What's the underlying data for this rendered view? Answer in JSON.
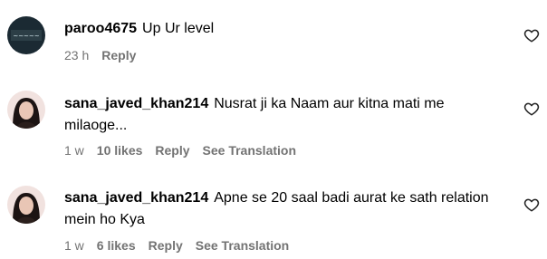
{
  "comments": [
    {
      "username": "paroo4675",
      "text": "Up Ur level",
      "time": "23 h",
      "likes": "",
      "reply_label": "Reply",
      "translation_label": ""
    },
    {
      "username": "sana_javed_khan214",
      "text": "Nusrat ji ka Naam aur kitna mati me milaoge...",
      "time": "1 w",
      "likes": "10 likes",
      "reply_label": "Reply",
      "translation_label": "See Translation"
    },
    {
      "username": "sana_javed_khan214",
      "text": "Apne se 20 saal badi aurat ke sath relation mein ho Kya",
      "time": "1 w",
      "likes": "6 likes",
      "reply_label": "Reply",
      "translation_label": "See Translation"
    }
  ],
  "icons": {
    "heart": "heart-outline-icon"
  },
  "colors": {
    "meta_text": "#737373",
    "avatar_dark": "#1b2a33"
  }
}
